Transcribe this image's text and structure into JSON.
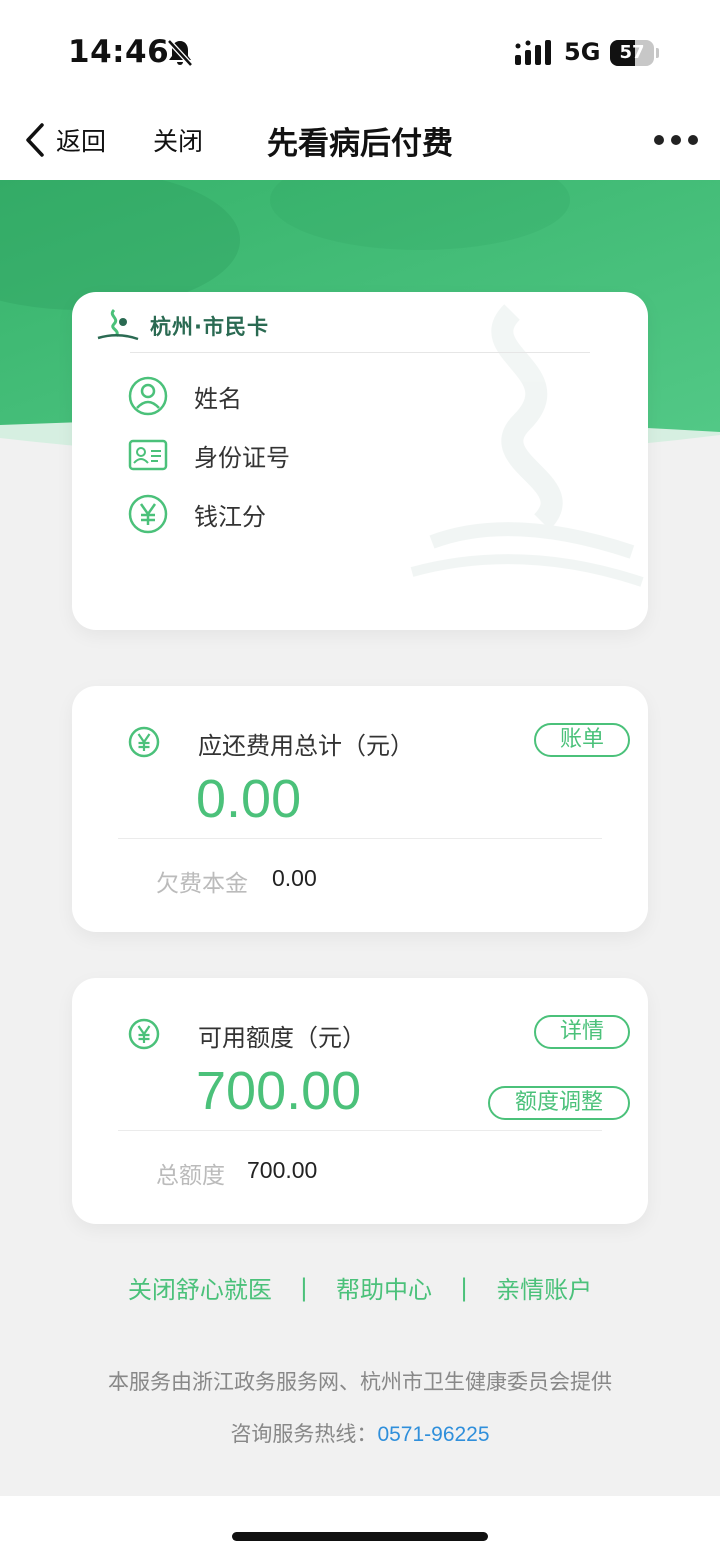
{
  "status_bar": {
    "time": "14:46",
    "network": "5G",
    "battery_level": 57,
    "battery_text": "57"
  },
  "nav": {
    "back_label": "返回",
    "close_label": "关闭",
    "title": "先看病后付费"
  },
  "id_card": {
    "brand": "杭州·市民卡",
    "rows": [
      {
        "icon": "user-icon",
        "label": "姓名"
      },
      {
        "icon": "id-card-icon",
        "label": "身份证号"
      },
      {
        "icon": "yen-circle-icon",
        "label": "钱江分"
      }
    ]
  },
  "bill": {
    "label": "应还费用总计（元）",
    "amount": "0.00",
    "button": "账单",
    "sub_label": "欠费本金",
    "sub_value": "0.00"
  },
  "limit": {
    "label": "可用额度（元）",
    "amount": "700.00",
    "detail_button": "详情",
    "adjust_button": "额度调整",
    "sub_label": "总额度",
    "sub_value": "700.00"
  },
  "links": [
    "关闭舒心就医",
    "|",
    "帮助中心",
    "|",
    "亲情账户"
  ],
  "footer": {
    "note": "本服务由浙江政务服务网、杭州市卫生健康委员会提供",
    "hotline_label": "咨询服务热线：",
    "hotline_number": "0571-96225"
  },
  "colors": {
    "accent": "#4bc17a",
    "banner": "#45c17b",
    "link_blue": "#2f8fdb"
  }
}
